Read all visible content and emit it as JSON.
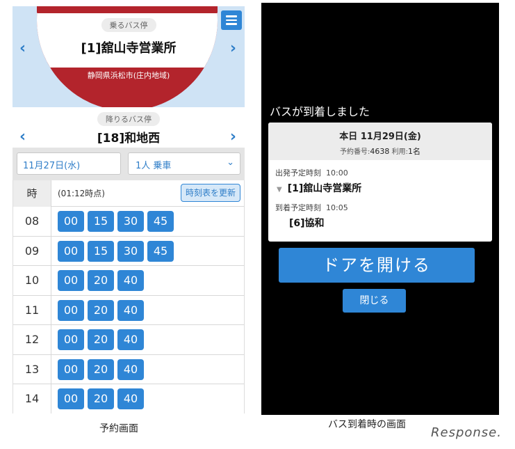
{
  "reservation_screen": {
    "boarding": {
      "label": "乗るバス停",
      "stop": "[1]舘山寺営業所",
      "area": "静岡県浜松市(庄内地域)"
    },
    "alighting": {
      "label": "降りるバス停",
      "stop": "[18]和地西"
    },
    "date": "11月27日(水)",
    "passengers": "1人 乗車",
    "timetable": {
      "hour_header": "時",
      "time_note": "(01:12時点)",
      "refresh_label": "時刻表を更新",
      "rows": [
        {
          "hour": "08",
          "minutes": [
            "00",
            "15",
            "30",
            "45"
          ]
        },
        {
          "hour": "09",
          "minutes": [
            "00",
            "15",
            "30",
            "45"
          ]
        },
        {
          "hour": "10",
          "minutes": [
            "00",
            "20",
            "40"
          ]
        },
        {
          "hour": "11",
          "minutes": [
            "00",
            "20",
            "40"
          ]
        },
        {
          "hour": "12",
          "minutes": [
            "00",
            "20",
            "40"
          ]
        },
        {
          "hour": "13",
          "minutes": [
            "00",
            "20",
            "40"
          ]
        },
        {
          "hour": "14",
          "minutes": [
            "00",
            "20",
            "40"
          ]
        }
      ]
    },
    "caption": "予約画面"
  },
  "arrival_screen": {
    "title": "バスが到着しました",
    "card": {
      "date": "本日 11月29日(金)",
      "reservation_label": "予約番号:",
      "reservation_number": "4638",
      "riders_label": "利用:",
      "riders": "1名",
      "departure_label": "出発予定時刻",
      "departure_time": "10:00",
      "departure_stop": "[1]舘山寺営業所",
      "arrival_label": "到着予定時刻",
      "arrival_time": "10:05",
      "arrival_stop": "[6]協和"
    },
    "open_door_label": "ドアを開ける",
    "close_label": "閉じる",
    "caption": "バス到着時の画面"
  },
  "watermark": "Response.",
  "colors": {
    "accent_blue": "#2f86d6",
    "brand_red": "#b3242c",
    "hero_bg": "#cfe3f5"
  },
  "icons": [
    "hamburger-menu-icon",
    "chevron-left-icon",
    "chevron-right-icon",
    "chevron-down-icon",
    "triangle-down-icon"
  ]
}
